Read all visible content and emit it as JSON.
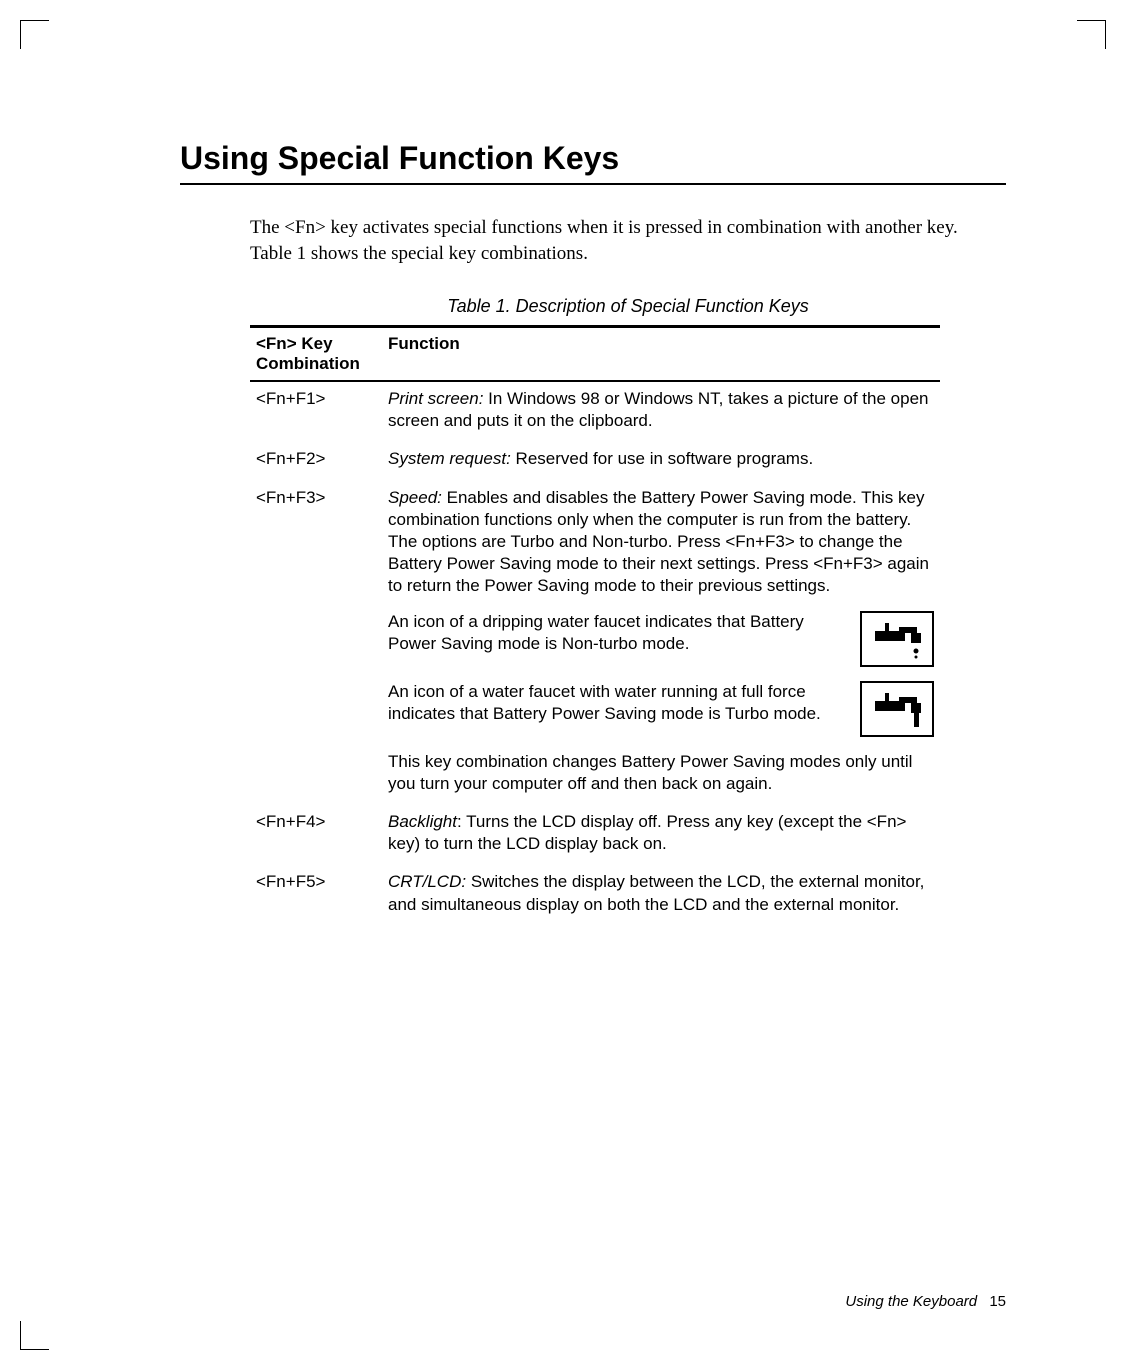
{
  "section_title": "Using Special Function Keys",
  "intro": "The <Fn> key activates special functions when it is pressed in combination with another key. Table 1 shows the special key combinations.",
  "table_caption": "Table 1.  Description of Special Function Keys",
  "header": {
    "col1_line1": "<Fn> Key",
    "col1_line2": "Combination",
    "col2": "Function"
  },
  "rows": {
    "f1": {
      "key": "<Fn+F1>",
      "lead": "Print screen:",
      "text": " In Windows 98 or Windows NT, takes a picture of the open screen and puts it on the clipboard."
    },
    "f2": {
      "key": "<Fn+F2>",
      "lead": "System request:",
      "text": " Reserved for use in software programs."
    },
    "f3": {
      "key": "<Fn+F3>",
      "lead": "Speed:",
      "text": " Enables and disables the Battery Power Saving mode. This key combination functions only when the computer is run from the battery. The options are Turbo and Non-turbo. Press <Fn+F3> to change the Battery Power Saving mode to their next settings. Press <Fn+F3> again to return the Power Saving mode to their previous settings.",
      "icon1": "An icon of a dripping water faucet indicates that Battery Power Saving mode is Non-turbo mode.",
      "icon2": "An icon of a water faucet with water running at full force indicates that Battery Power Saving mode is Turbo mode.",
      "tail": "This key combination changes Battery Power Saving modes only until you turn your computer off and then back on again."
    },
    "f4": {
      "key": "<Fn+F4>",
      "lead": "Backlight",
      "text": ": Turns the LCD display off. Press any key (except the <Fn> key) to turn the LCD display back on."
    },
    "f5": {
      "key": "<Fn+F5>",
      "lead": "CRT/LCD:",
      "text": " Switches the display between the LCD, the external monitor, and simultaneous display on both the LCD and the external monitor."
    }
  },
  "footer": {
    "text": "Using the Keyboard",
    "page": "15"
  }
}
